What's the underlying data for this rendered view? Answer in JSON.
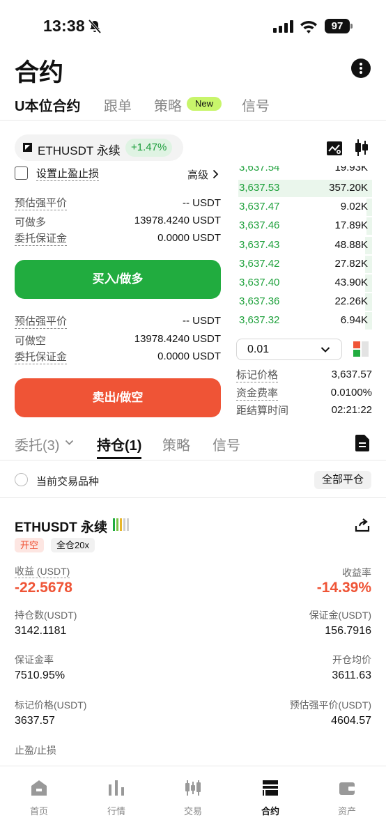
{
  "status": {
    "time": "13:38",
    "battery": "97"
  },
  "header": {
    "title": "合约"
  },
  "top_tabs": [
    {
      "label": "U本位合约",
      "active": true
    },
    {
      "label": "跟单"
    },
    {
      "label": "策略"
    },
    {
      "label": "信号"
    }
  ],
  "new_badge": "New",
  "pair": {
    "name": "ETHUSDT 永续",
    "change": "+1.47%"
  },
  "order_form": {
    "tpsl_label": "设置止盈止损",
    "advanced_label": "高级",
    "long": {
      "liq_label": "预估强平价",
      "liq_value": "-- USDT",
      "avail_label": "可做多",
      "avail_value": "13978.4240 USDT",
      "margin_label": "委托保证金",
      "margin_value": "0.0000 USDT",
      "button": "买入/做多"
    },
    "short": {
      "liq_label": "预估强平价",
      "liq_value": "-- USDT",
      "avail_label": "可做空",
      "avail_value": "13978.4240 USDT",
      "margin_label": "委托保证金",
      "margin_value": "0.0000 USDT",
      "button": "卖出/做空"
    }
  },
  "orderbook": {
    "partial_top": {
      "price": "3,637.54",
      "qty": "19.93K"
    },
    "bids": [
      {
        "price": "3,637.53",
        "qty": "357.20K",
        "depth": 0.98
      },
      {
        "price": "3,637.47",
        "qty": "9.02K",
        "depth": 0.04
      },
      {
        "price": "3,637.46",
        "qty": "17.89K",
        "depth": 0.04
      },
      {
        "price": "3,637.43",
        "qty": "48.88K",
        "depth": 0.05
      },
      {
        "price": "3,637.42",
        "qty": "27.82K",
        "depth": 0.05
      },
      {
        "price": "3,637.40",
        "qty": "43.90K",
        "depth": 0.05
      },
      {
        "price": "3,637.36",
        "qty": "22.26K",
        "depth": 0.05
      },
      {
        "price": "3,637.32",
        "qty": "6.94K",
        "depth": 0.05
      }
    ],
    "precision": "0.01"
  },
  "market_info": [
    {
      "label": "标记价格",
      "value": "3,637.57"
    },
    {
      "label": "资金费率",
      "value": "0.0100%"
    },
    {
      "label": "距结算时间",
      "value": "02:21:22"
    }
  ],
  "section_tabs": [
    {
      "label": "委托(3)"
    },
    {
      "label": "持仓(1)",
      "active": true
    },
    {
      "label": "策略"
    },
    {
      "label": "信号"
    }
  ],
  "filter": {
    "current_pair": "当前交易品种",
    "close_all": "全部平仓"
  },
  "position": {
    "title": "ETHUSDT 永续",
    "side_tag": "开空",
    "mode_tag": "全仓20x",
    "pnl_label": "收益 (USDT)",
    "pnl_value": "-22.5678",
    "roe_label": "收益率",
    "roe_value": "-14.39%",
    "size_label": "持仓数(USDT)",
    "size_value": "3142.1181",
    "margin_label": "保证金(USDT)",
    "margin_value": "156.7916",
    "margin_ratio_label": "保证金率",
    "margin_ratio_value": "7510.95%",
    "entry_label": "开仓均价",
    "entry_value": "3611.63",
    "mark_label": "标记价格(USDT)",
    "mark_value": "3637.57",
    "liq_label": "预估强平价(USDT)",
    "liq_value": "4604.57",
    "tpsl_label": "止盈/止损"
  },
  "bottom_nav": [
    {
      "label": "首页",
      "icon": "home-icon"
    },
    {
      "label": "行情",
      "icon": "market-icon"
    },
    {
      "label": "交易",
      "icon": "trade-icon"
    },
    {
      "label": "合约",
      "icon": "futures-icon",
      "active": true
    },
    {
      "label": "资产",
      "icon": "wallet-icon"
    }
  ],
  "colors": {
    "buy": "#21ac3f",
    "sell": "#ef5436",
    "accent_badge": "#c8f56b"
  }
}
